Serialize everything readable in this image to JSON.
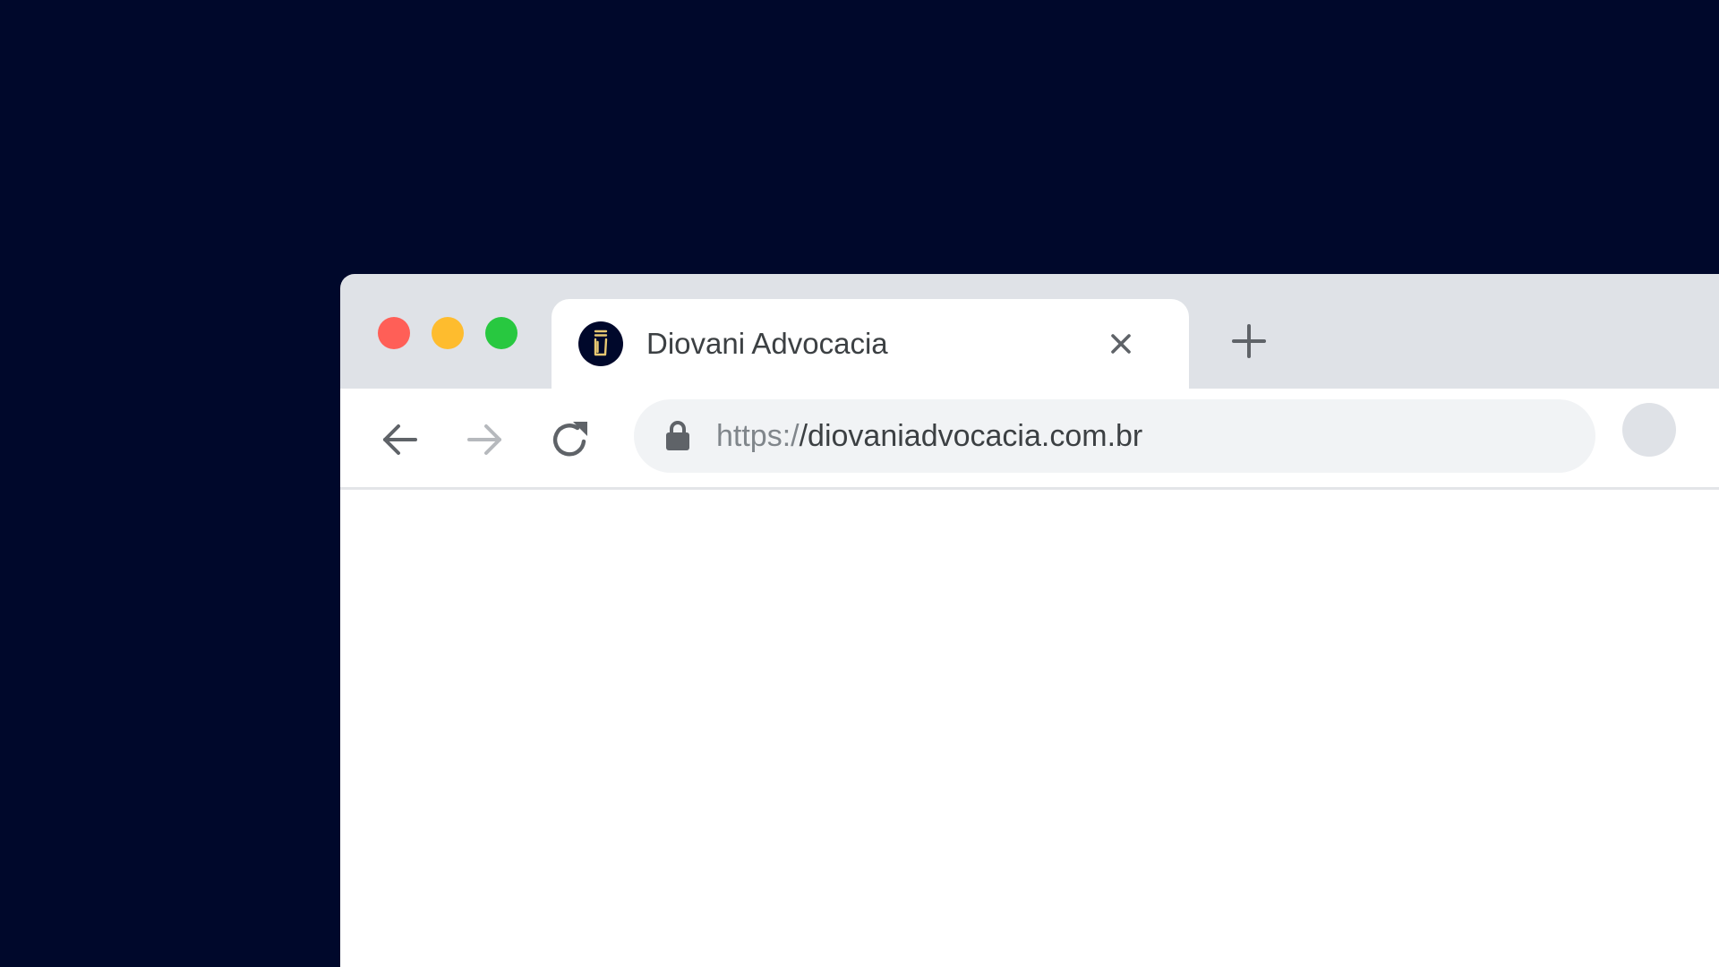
{
  "colors": {
    "backdrop": "#00082b",
    "tabstrip": "#dfe2e7",
    "tab_bg": "#ffffff",
    "toolbar_bg": "#ffffff",
    "omnibox_bg": "#f1f3f5",
    "divider": "#e3e5e8",
    "icon": "#5f6368",
    "icon_disabled": "#b6b9bd",
    "text_main": "#3c4043",
    "text_muted": "#80868b",
    "profile": "#dfe2e7",
    "traffic_red": "#ff5f57",
    "traffic_yellow": "#febc2e",
    "traffic_green": "#28c840",
    "favicon_bg": "#00082b",
    "favicon_fg": "#e8c872",
    "content_bg": "#ffffff"
  },
  "window_controls": {
    "close_icon": "traffic-light-close",
    "minimize_icon": "traffic-light-minimize",
    "maximize_icon": "traffic-light-maximize"
  },
  "tab": {
    "title": "Diovani Advocacia",
    "favicon_icon": "diovani-logo-icon",
    "close_icon": "close-icon"
  },
  "new_tab_icon": "plus-icon",
  "toolbar": {
    "back_icon": "arrow-left-icon",
    "forward_icon": "arrow-right-icon",
    "reload_icon": "reload-icon",
    "lock_icon": "lock-icon",
    "url_scheme": "https:/",
    "url_host": "/diovaniadvocacia.com.br",
    "profile_icon": "avatar-placeholder"
  }
}
